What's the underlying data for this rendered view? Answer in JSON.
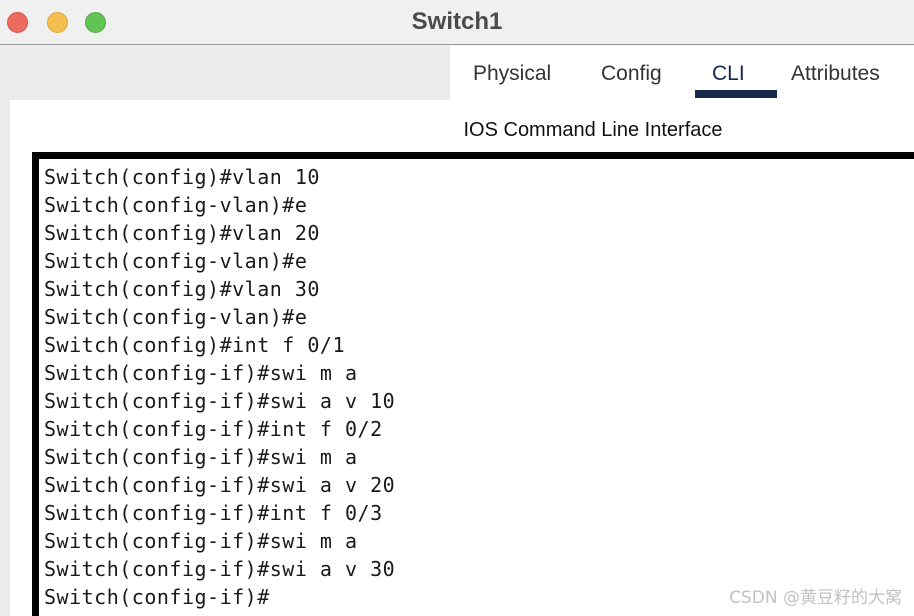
{
  "window": {
    "title": "Switch1",
    "controls": [
      {
        "name": "close",
        "icon": "close-traffic-light",
        "color": "#ec6a5e"
      },
      {
        "name": "minimize",
        "icon": "minimize-traffic-light",
        "color": "#f4bd4f"
      },
      {
        "name": "maximize",
        "icon": "maximize-traffic-light",
        "color": "#61c555"
      }
    ]
  },
  "tabs": {
    "items": [
      {
        "label": "Physical",
        "active": false
      },
      {
        "label": "Config",
        "active": false
      },
      {
        "label": "CLI",
        "active": true
      },
      {
        "label": "Attributes",
        "active": false
      }
    ],
    "active_label": "CLI",
    "active_color": "#16294d"
  },
  "panel": {
    "caption": "IOS Command Line Interface"
  },
  "terminal": {
    "lines": [
      "Switch(config)#vlan 10",
      "Switch(config-vlan)#e",
      "Switch(config)#vlan 20",
      "Switch(config-vlan)#e",
      "Switch(config)#vlan 30",
      "Switch(config-vlan)#e",
      "Switch(config)#int f 0/1",
      "Switch(config-if)#swi m a",
      "Switch(config-if)#swi a v 10",
      "Switch(config-if)#int f 0/2",
      "Switch(config-if)#swi m a",
      "Switch(config-if)#swi a v 20",
      "Switch(config-if)#int f 0/3",
      "Switch(config-if)#swi m a",
      "Switch(config-if)#swi a v 30",
      "Switch(config-if)#"
    ],
    "background": "#ffffff",
    "foreground": "#1a1a1a",
    "border_color": "#000000"
  },
  "watermark": {
    "text": "CSDN @黄豆籽的大窝",
    "color": "#c2c2c2"
  }
}
